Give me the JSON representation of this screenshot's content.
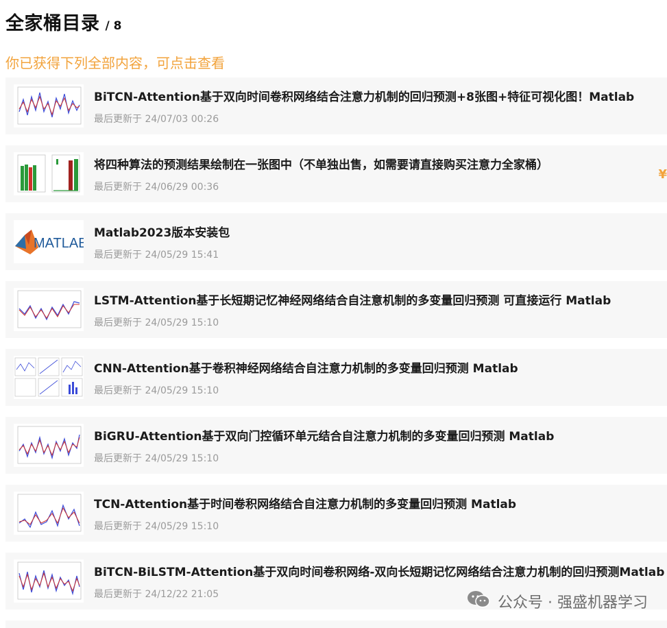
{
  "header": {
    "title": "全家桶目录",
    "count": "/ 8",
    "subtitle": "你已获得下列全部内容，可点击查看"
  },
  "items": [
    {
      "title": "BiTCN-Attention基于双向时间卷积网络结合注意力机制的回归预测+8张图+特征可视化图！Matlab",
      "date": "最后更新于 24/07/03 00:26",
      "thumb": "line-chart"
    },
    {
      "title": "将四种算法的预测结果绘制在一张图中（不单独出售，如需要请直接购买注意力全家桶）",
      "date": "最后更新于 24/06/29 00:36",
      "thumb": "bar-chart"
    },
    {
      "title": "Matlab2023版本安装包",
      "date": "最后更新于 24/05/29 15:41",
      "thumb": "matlab-logo"
    },
    {
      "title": "LSTM-Attention基于长短期记忆神经网络结合自注意机制的多变量回归预测 可直接运行 Matlab",
      "date": "最后更新于 24/05/29 15:10",
      "thumb": "line-chart"
    },
    {
      "title": "CNN-Attention基于卷积神经网络结合自注意力机制的多变量回归预测 Matlab",
      "date": "最后更新于 24/05/29 15:10",
      "thumb": "multi-chart"
    },
    {
      "title": "BiGRU-Attention基于双向门控循环单元结合自注意力机制的多变量回归预测 Matlab",
      "date": "最后更新于 24/05/29 15:10",
      "thumb": "line-chart"
    },
    {
      "title": "TCN-Attention基于时间卷积网络结合自注意力机制的多变量回归预测 Matlab",
      "date": "最后更新于 24/05/29 15:10",
      "thumb": "line-chart"
    },
    {
      "title": "BiTCN-BiLSTM-Attention基于双向时间卷积网络-双向长短期记忆网络结合注意力机制的回归预测Matlab",
      "date": "最后更新于 24/12/22 21:05",
      "thumb": "line-chart"
    }
  ],
  "logo_text": "MATLAB",
  "edge_mark": "¥",
  "watermark": "公众号 · 强盛机器学习",
  "colors": {
    "accent": "#f2a33c",
    "item_bg": "#f7f7f7",
    "date": "#9a9a9a"
  }
}
